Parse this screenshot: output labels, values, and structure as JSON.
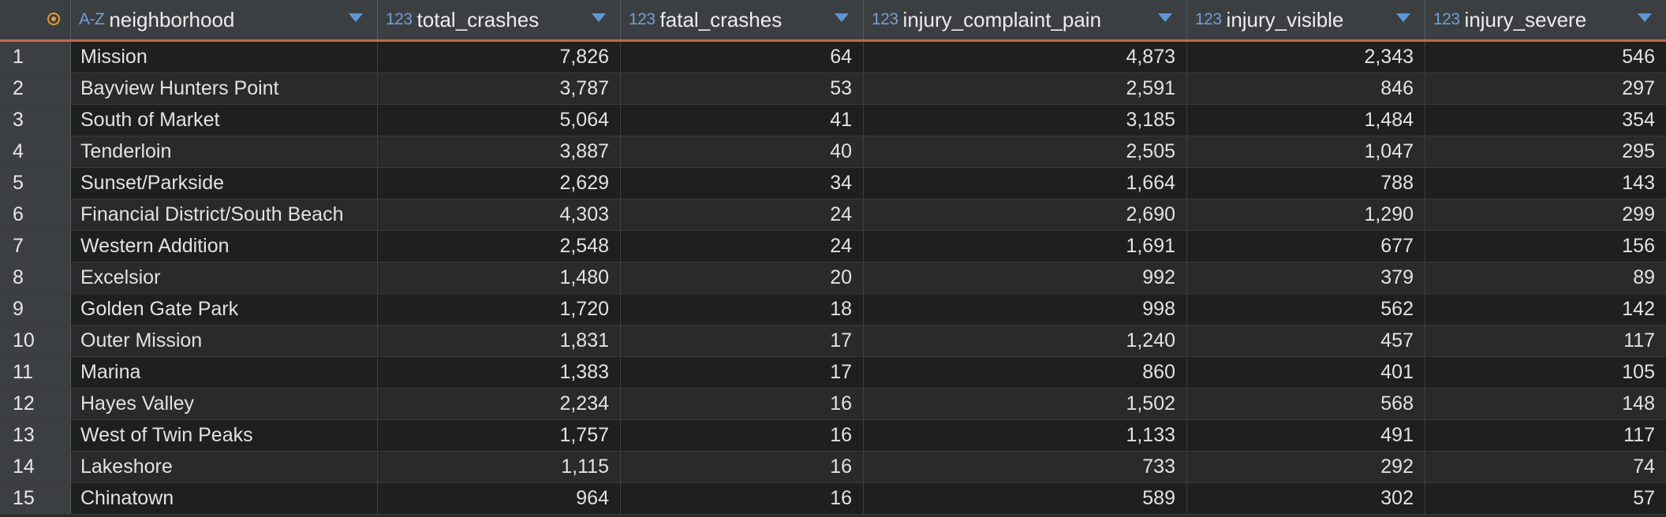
{
  "columns": [
    {
      "type": "A-Z",
      "name": "neighborhood"
    },
    {
      "type": "123",
      "name": "total_crashes"
    },
    {
      "type": "123",
      "name": "fatal_crashes"
    },
    {
      "type": "123",
      "name": "injury_complaint_pain"
    },
    {
      "type": "123",
      "name": "injury_visible"
    },
    {
      "type": "123",
      "name": "injury_severe"
    }
  ],
  "rows": [
    {
      "n": "1",
      "neighborhood": "Mission",
      "total_crashes": "7,826",
      "fatal_crashes": "64",
      "injury_complaint_pain": "4,873",
      "injury_visible": "2,343",
      "injury_severe": "546"
    },
    {
      "n": "2",
      "neighborhood": "Bayview Hunters Point",
      "total_crashes": "3,787",
      "fatal_crashes": "53",
      "injury_complaint_pain": "2,591",
      "injury_visible": "846",
      "injury_severe": "297"
    },
    {
      "n": "3",
      "neighborhood": "South of Market",
      "total_crashes": "5,064",
      "fatal_crashes": "41",
      "injury_complaint_pain": "3,185",
      "injury_visible": "1,484",
      "injury_severe": "354"
    },
    {
      "n": "4",
      "neighborhood": "Tenderloin",
      "total_crashes": "3,887",
      "fatal_crashes": "40",
      "injury_complaint_pain": "2,505",
      "injury_visible": "1,047",
      "injury_severe": "295"
    },
    {
      "n": "5",
      "neighborhood": "Sunset/Parkside",
      "total_crashes": "2,629",
      "fatal_crashes": "34",
      "injury_complaint_pain": "1,664",
      "injury_visible": "788",
      "injury_severe": "143"
    },
    {
      "n": "6",
      "neighborhood": "Financial District/South Beach",
      "total_crashes": "4,303",
      "fatal_crashes": "24",
      "injury_complaint_pain": "2,690",
      "injury_visible": "1,290",
      "injury_severe": "299"
    },
    {
      "n": "7",
      "neighborhood": "Western Addition",
      "total_crashes": "2,548",
      "fatal_crashes": "24",
      "injury_complaint_pain": "1,691",
      "injury_visible": "677",
      "injury_severe": "156"
    },
    {
      "n": "8",
      "neighborhood": "Excelsior",
      "total_crashes": "1,480",
      "fatal_crashes": "20",
      "injury_complaint_pain": "992",
      "injury_visible": "379",
      "injury_severe": "89"
    },
    {
      "n": "9",
      "neighborhood": "Golden Gate Park",
      "total_crashes": "1,720",
      "fatal_crashes": "18",
      "injury_complaint_pain": "998",
      "injury_visible": "562",
      "injury_severe": "142"
    },
    {
      "n": "10",
      "neighborhood": "Outer Mission",
      "total_crashes": "1,831",
      "fatal_crashes": "17",
      "injury_complaint_pain": "1,240",
      "injury_visible": "457",
      "injury_severe": "117"
    },
    {
      "n": "11",
      "neighborhood": "Marina",
      "total_crashes": "1,383",
      "fatal_crashes": "17",
      "injury_complaint_pain": "860",
      "injury_visible": "401",
      "injury_severe": "105"
    },
    {
      "n": "12",
      "neighborhood": "Hayes Valley",
      "total_crashes": "2,234",
      "fatal_crashes": "16",
      "injury_complaint_pain": "1,502",
      "injury_visible": "568",
      "injury_severe": "148"
    },
    {
      "n": "13",
      "neighborhood": "West of Twin Peaks",
      "total_crashes": "1,757",
      "fatal_crashes": "16",
      "injury_complaint_pain": "1,133",
      "injury_visible": "491",
      "injury_severe": "117"
    },
    {
      "n": "14",
      "neighborhood": "Lakeshore",
      "total_crashes": "1,115",
      "fatal_crashes": "16",
      "injury_complaint_pain": "733",
      "injury_visible": "292",
      "injury_severe": "74"
    },
    {
      "n": "15",
      "neighborhood": "Chinatown",
      "total_crashes": "964",
      "fatal_crashes": "16",
      "injury_complaint_pain": "589",
      "injury_visible": "302",
      "injury_severe": "57"
    }
  ]
}
